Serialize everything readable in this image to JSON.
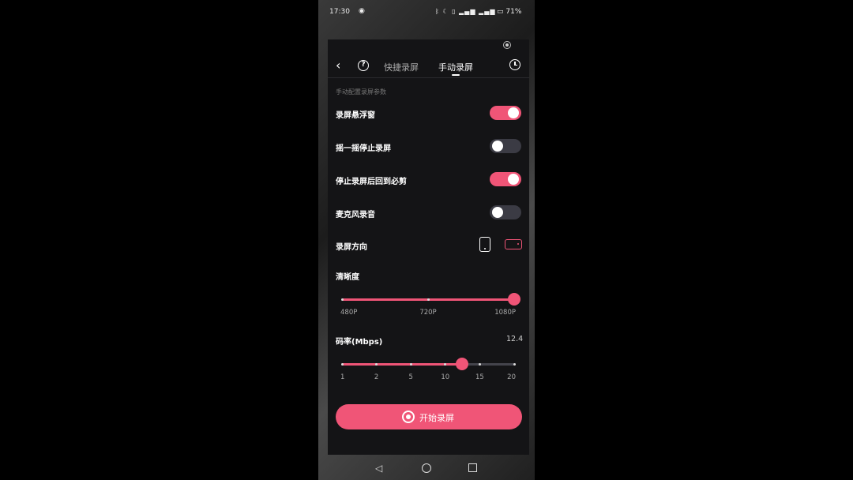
{
  "status_bar": {
    "time": "17:30",
    "battery": "71%",
    "icons": [
      "bluetooth-icon",
      "moon-icon",
      "vibrate-icon",
      "signal-icon",
      "wifi-icon",
      "battery-icon"
    ]
  },
  "header": {
    "tabs": [
      {
        "label": "快捷录屏",
        "active": false
      },
      {
        "label": "手动录屏",
        "active": true
      }
    ]
  },
  "settings": {
    "section_label": "手动配置录屏参数",
    "toggles": [
      {
        "label": "录屏悬浮窗",
        "on": true
      },
      {
        "label": "摇一摇停止录屏",
        "on": false
      },
      {
        "label": "停止录屏后回到必剪",
        "on": true
      },
      {
        "label": "麦克风录音",
        "on": false
      }
    ],
    "orientation": {
      "label": "录屏方向",
      "options": [
        "portrait",
        "landscape"
      ],
      "selected": "landscape"
    }
  },
  "resolution": {
    "label": "清晰度",
    "options": [
      "480P",
      "720P",
      "1080P"
    ],
    "selected": "1080P"
  },
  "bitrate": {
    "label": "码率(Mbps)",
    "value": "12.4",
    "ticks": [
      "1",
      "2",
      "5",
      "10",
      "15",
      "20"
    ]
  },
  "start_button": {
    "label": "开始录屏"
  },
  "colors": {
    "accent": "#f05577",
    "panel": "#141416",
    "toggle_off": "#3b3b44"
  }
}
